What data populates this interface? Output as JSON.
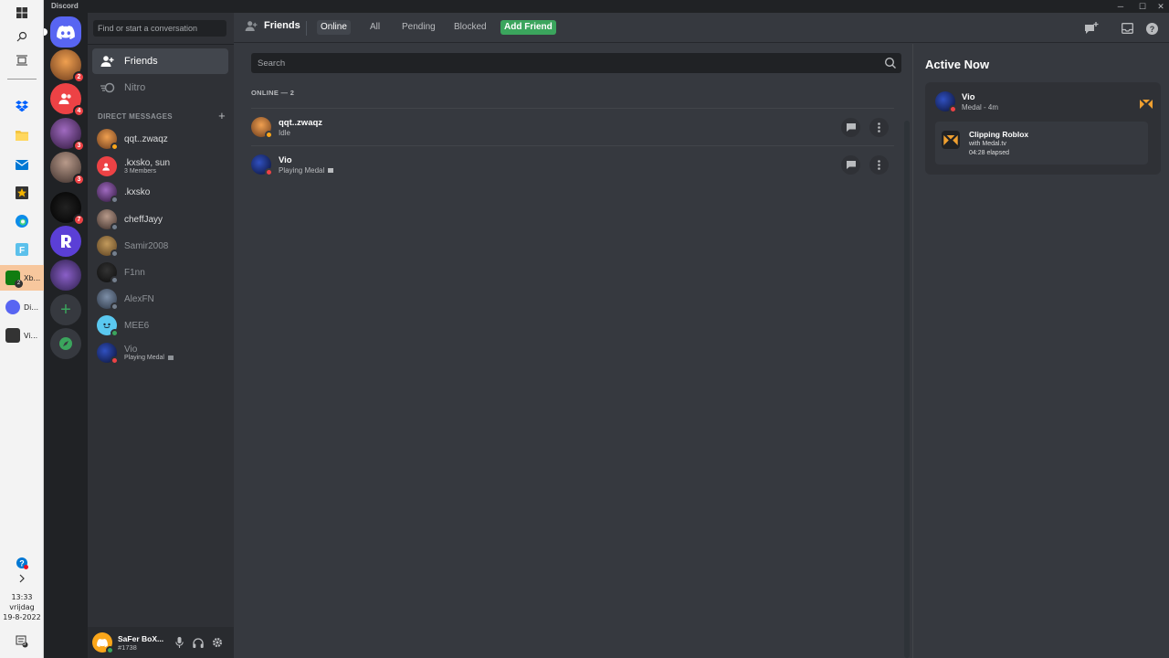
{
  "window": {
    "app_title": "Discord"
  },
  "taskbar": {
    "apps": [
      {
        "label": "Xb...",
        "badge": "2"
      },
      {
        "label": "Di..."
      },
      {
        "label": "Vi..."
      }
    ],
    "clock": {
      "time": "13:33",
      "day": "vrijdag",
      "date": "19-8-2022"
    },
    "notification_count": "5"
  },
  "guilds": {
    "badges": [
      "2",
      "4",
      "3",
      "3",
      "7"
    ]
  },
  "sidebar": {
    "search_placeholder": "Find or start a conversation",
    "nav": [
      {
        "label": "Friends"
      },
      {
        "label": "Nitro"
      }
    ],
    "dm_header": "DIRECT MESSAGES",
    "dms": [
      {
        "name": "qqt..zwaqz",
        "sub": ""
      },
      {
        "name": ".kxsko, sun",
        "sub": "3 Members"
      },
      {
        "name": ".kxsko",
        "sub": ""
      },
      {
        "name": "cheffJayy",
        "sub": ""
      },
      {
        "name": "Samir2008",
        "sub": ""
      },
      {
        "name": "F1nn",
        "sub": ""
      },
      {
        "name": "AlexFN",
        "sub": ""
      },
      {
        "name": "MEE6",
        "sub": ""
      },
      {
        "name": "Vio",
        "sub": "Playing Medal"
      }
    ]
  },
  "user": {
    "name": "SaFer BoX...",
    "tag": "#1738"
  },
  "topbar": {
    "title": "Friends",
    "tabs": [
      "Online",
      "All",
      "Pending",
      "Blocked"
    ],
    "add_friend": "Add Friend"
  },
  "friends": {
    "search_placeholder": "Search",
    "online_header": "ONLINE — 2",
    "list": [
      {
        "name": "qqt..zwaqz",
        "status": "Idle"
      },
      {
        "name": "Vio",
        "status": "Playing Medal"
      }
    ]
  },
  "active_now": {
    "title": "Active Now",
    "card": {
      "name": "Vio",
      "sub": "Medal - 4m",
      "activity_title": "Clipping Roblox",
      "activity_with": "with Medal.tv",
      "activity_elapsed": "04:28 elapsed"
    }
  },
  "colors": {
    "blurple": "#5865f2",
    "green": "#3ba55d",
    "red": "#ed4245",
    "idle": "#faa61a",
    "medal": "#f0a030"
  }
}
